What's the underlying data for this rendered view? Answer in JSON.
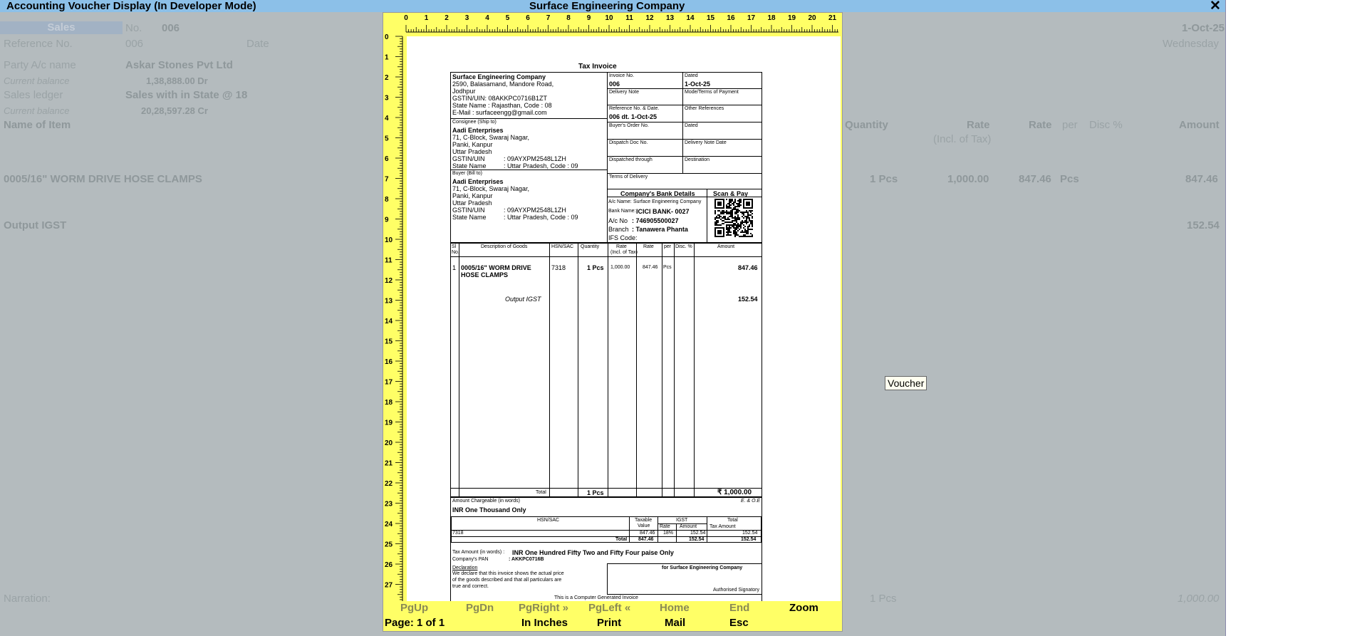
{
  "window": {
    "left_title": "Accounting Voucher Display (In Developer Mode)",
    "center_title": "Surface Engineering Company",
    "close_glyph": "✕"
  },
  "voucher": {
    "type": "Sales",
    "no_label": "No.",
    "no_value": "006",
    "reference_label": "Reference No.",
    "reference_value": "006",
    "date_label": "Date",
    "date_value": "1-Oct-25",
    "day_value": "Wednesday",
    "party_label": "Party A/c name",
    "party_value": "Askar Stones Pvt Ltd",
    "current_balance_label": "Current balance",
    "party_balance": "1,38,888.00 Dr",
    "sales_ledger_label": "Sales ledger",
    "sales_ledger_value": "Sales with in State @ 18",
    "sales_balance": "20,28,597.28 Cr",
    "col_item": "Name of Item",
    "col_quantity": "Quantity",
    "col_rate_incl": "Rate",
    "col_rate_incl_sub": "(Incl. of Tax)",
    "col_rate": "Rate",
    "col_per": "per",
    "col_disc": "Disc %",
    "col_amount": "Amount",
    "item_name": "0005/16\" WORM DRIVE HOSE CLAMPS",
    "item_qty": "1 Pcs",
    "item_rate_incl": "1,000.00",
    "item_rate": "847.46",
    "item_per": "Pcs",
    "item_amount": "847.46",
    "tax_ledger": "Output IGST",
    "tax_amount": "152.54",
    "narration_label": "Narration:",
    "total_qty": "1 Pcs",
    "total_amount": "1,000.00"
  },
  "tooltip": "Voucher",
  "ruler": {
    "top": [
      "0",
      "1",
      "2",
      "3",
      "4",
      "5",
      "6",
      "7",
      "8",
      "9",
      "10",
      "11",
      "12",
      "13",
      "14",
      "15",
      "16",
      "17",
      "18",
      "19",
      "20",
      "21"
    ],
    "left": [
      "0",
      "1",
      "2",
      "3",
      "4",
      "5",
      "6",
      "7",
      "8",
      "9",
      "10",
      "11",
      "12",
      "13",
      "14",
      "15",
      "16",
      "17",
      "18",
      "19",
      "20",
      "21",
      "22",
      "23",
      "24",
      "25",
      "26",
      "27"
    ]
  },
  "bottom_bar": {
    "pgup": "PgUp",
    "pgdn": "PgDn",
    "pgright": "PgRight »",
    "pgleft": "PgLeft «",
    "home": "Home",
    "end": "End",
    "zoom": "Zoom",
    "page": "Page: 1 of 1",
    "inches": "In Inches",
    "print": "Print",
    "mail": "Mail",
    "esc": "Esc"
  },
  "invoice": {
    "title": "Tax Invoice",
    "seller_name": "Surface Engineering Company",
    "seller_addr1": "2590, Balasamand, Mandore Road,",
    "seller_addr2": "Jodhpur",
    "seller_gst": "GSTIN/UIN: 08AKKPC0716B1ZT",
    "seller_state": "State Name : Rajasthan, Code : 08",
    "seller_email": "E-Mail : surfaceengg@gmail.com",
    "consignee_label": "Consignee (Ship to)",
    "consignee_name": "Aadi Enterprises",
    "consignee_addr1": "71, C-Block, Swaraj Nagar,",
    "consignee_addr2": "Panki, Kanpur",
    "consignee_addr3": "Uttar Pradesh",
    "consignee_gst_label": "GSTIN/UIN",
    "consignee_gst": ": 09AYXPM2548L1ZH",
    "consignee_state_label": "State Name",
    "consignee_state": ": Uttar Pradesh, Code : 09",
    "buyer_label": "Buyer (Bill to)",
    "buyer_name": "Aadi Enterprises",
    "buyer_addr1": "71, C-Block, Swaraj Nagar,",
    "buyer_addr2": "Panki, Kanpur",
    "buyer_addr3": "Uttar Pradesh",
    "buyer_gst_label": "GSTIN/UIN",
    "buyer_gst": ": 09AYXPM2548L1ZH",
    "buyer_state_label": "State Name",
    "buyer_state": ": Uttar Pradesh, Code : 09",
    "invoice_no_label": "Invoice No.",
    "invoice_no": "006",
    "dated_label": "Dated",
    "dated": "1-Oct-25",
    "delivery_note": "Delivery Note",
    "mode_terms": "Mode/Terms of Payment",
    "ref_label": "Reference No. & Date.",
    "ref_value": "006 dt. 1-Oct-25",
    "other_refs": "Other References",
    "buyers_order": "Buyer's Order No.",
    "dated2": "Dated",
    "dispatch_doc": "Dispatch Doc No.",
    "delivery_note_date": "Delivery Note Date",
    "dispatched_through": "Dispatched through",
    "destination": "Destination",
    "terms_delivery": "Terms of Delivery",
    "bank_title": "Company's Bank Details",
    "scan_pay": "Scan & Pay",
    "bank_ac_name_label": "A/c Name:",
    "bank_ac_name": "Surface Engineering Company",
    "bank_name_label": "Bank Name:",
    "bank_name": "ICICI BANK- 0027",
    "bank_ac_no_label": "A/c No",
    "bank_ac_no": ": 746905500027",
    "bank_branch_label": "Branch",
    "bank_branch": ": Tanawera Phanta",
    "bank_ifs_label": "IFS Code:",
    "th_sl": "Sl",
    "th_sl2": "No.",
    "th_desc": "Description of Goods",
    "th_hsn": "HSN/SAC",
    "th_qty": "Quantity",
    "th_rate_incl": "Rate",
    "th_rate_incl_sub": "(Incl. of Tax)",
    "th_rate": "Rate",
    "th_per": "per",
    "th_disc": "Disc. %",
    "th_amount": "Amount",
    "row_sl": "1",
    "row_desc1": "0005/16\" WORM DRIVE",
    "row_desc2": "HOSE CLAMPS",
    "row_hsn": "7318",
    "row_qty": "1 Pcs",
    "row_rate_incl": "1,000.00",
    "row_rate": "847.46",
    "row_per": "Pcs",
    "row_amount": "847.46",
    "tax_label": "Output IGST",
    "tax_amount": "152.54",
    "total_label": "Total",
    "total_qty": "1 Pcs",
    "total_amount": "₹ 1,000.00",
    "amount_words_label": "Amount Chargeable (in words)",
    "eoe": "E. & O.E",
    "amount_words": "INR One Thousand Only",
    "hsn_h": "HSN/SAC",
    "taxable_h": "Taxable",
    "taxable_h2": "Value",
    "igst_h": "IGST",
    "igst_rate_h": "Rate",
    "igst_amt_h": "Amount",
    "total_tax_h": "Total",
    "total_tax_h2": "Tax Amount",
    "hsn_row": "7318",
    "taxable_row": "847.46",
    "rate_row": "18%",
    "igst_row": "152.54",
    "totaltax_row": "152.54",
    "hsn_total_label": "Total",
    "taxable_total": "847.46",
    "igst_total": "152.54",
    "totaltax_total": "152.54",
    "tax_words_label": "Tax Amount (in words) :",
    "tax_words": "INR One Hundred Fifty Two and Fifty Four paise Only",
    "pan_label": "Company's PAN",
    "pan": ": AKKPC0716B",
    "declaration_label": "Declaration",
    "decl1": "We declare that this invoice shows the actual price",
    "decl2": "of the goods described and that all particulars are",
    "decl3": "true and correct.",
    "for_company": "for Surface Engineering Company",
    "auth_sign": "Authorised Signatory",
    "footer": "This is a Computer Generated Invoice"
  }
}
